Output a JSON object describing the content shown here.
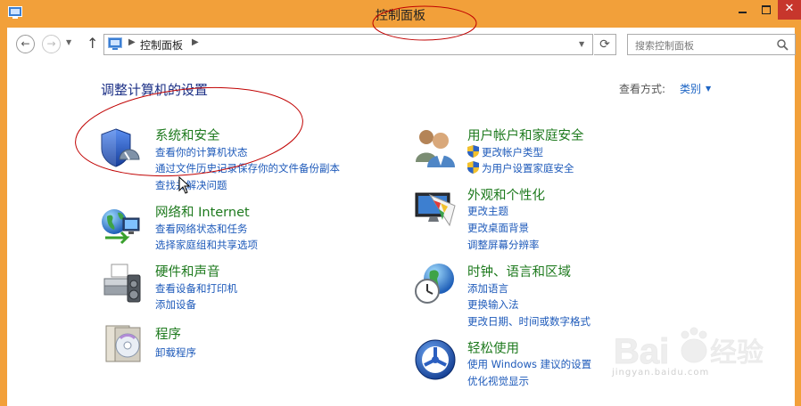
{
  "window": {
    "title": "控制面板",
    "close_glyph": "✕"
  },
  "nav": {
    "breadcrumb": "控制面板",
    "search_placeholder": "搜索控制面板"
  },
  "heading": "调整计算机的设置",
  "view_by": {
    "label": "查看方式:",
    "value": "类别"
  },
  "categories": [
    {
      "title": "系统和安全",
      "icon": "shield-icon",
      "links": [
        "查看你的计算机状态",
        "通过文件历史记录保存你的文件备份副本",
        "查找并解决问题"
      ]
    },
    {
      "title": "网络和 Internet",
      "icon": "network-globe-icon",
      "links": [
        "查看网络状态和任务",
        "选择家庭组和共享选项"
      ]
    },
    {
      "title": "硬件和声音",
      "icon": "printer-icon",
      "links": [
        "查看设备和打印机",
        "添加设备"
      ]
    },
    {
      "title": "程序",
      "icon": "programs-icon",
      "links": [
        "卸载程序"
      ]
    },
    {
      "title": "用户帐户和家庭安全",
      "icon": "users-icon",
      "links": [
        "更改帐户类型",
        "为用户设置家庭安全"
      ]
    },
    {
      "title": "外观和个性化",
      "icon": "monitor-palette-icon",
      "links": [
        "更改主题",
        "更改桌面背景",
        "调整屏幕分辨率"
      ]
    },
    {
      "title": "时钟、语言和区域",
      "icon": "clock-globe-icon",
      "links": [
        "添加语言",
        "更换输入法",
        "更改日期、时间或数字格式"
      ]
    },
    {
      "title": "轻松使用",
      "icon": "ease-of-access-icon",
      "links": [
        "使用 Windows 建议的设置",
        "优化视觉显示"
      ]
    }
  ],
  "watermark": {
    "text": "jingyan.baidu.com"
  },
  "colors": {
    "titlebar": "#f2a03a",
    "category_title": "#1e7a1e",
    "link": "#1e5aba",
    "heading": "#1e3287",
    "annotation": "#c00000"
  }
}
